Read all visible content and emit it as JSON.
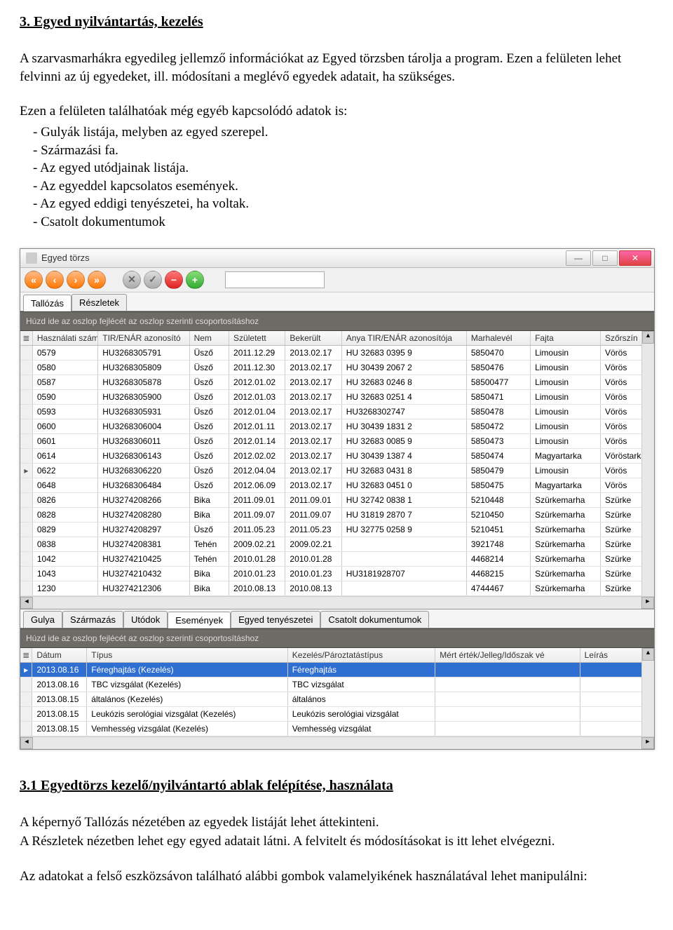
{
  "doc": {
    "h1": "3. Egyed nyilvántartás, kezelés",
    "p1": "A szarvasmarhákra egyedileg jellemző információkat az Egyed törzsben tárolja a program. Ezen a felületen lehet felvinni az új egyedeket, ill. módosítani a meglévő egyedek adatait, ha szükséges.",
    "p2": "Ezen a felületen találhatóak még egyéb kapcsolódó adatok is:",
    "list": [
      "Gulyák listája, melyben az egyed szerepel.",
      "Származási fa.",
      "Az egyed utódjainak listája.",
      "Az egyeddel kapcsolatos események.",
      "Az egyed eddigi tenyészetei, ha voltak.",
      "Csatolt dokumentumok"
    ],
    "h2": "3.1 Egyedtörzs kezelő/nyilvántartó ablak felépítése, használata",
    "p3": "A képernyő Tallózás nézetében az egyedek listáját lehet áttekinteni.",
    "p4": "A Részletek nézetben lehet egy egyed adatait látni. A felvitelt és módosításokat is itt lehet elvégezni.",
    "p5": "Az adatokat a felső eszközsávon található alábbi gombok valamelyikének használatával lehet manipulálni:"
  },
  "window": {
    "title": "Egyed törzs",
    "tabs": [
      "Tallózás",
      "Részletek"
    ],
    "group_hint": "Húzd ide az oszlop fejlécét az oszlop szerinti csoportosításhoz",
    "top_columns": [
      "Használati szám",
      "TIR/ENÁR azonosító",
      "Nem",
      "Született",
      "Bekerült",
      "Anya TIR/ENÁR azonosítója",
      "Marhalevél",
      "Fajta",
      "Szőrszín"
    ],
    "top_rows": [
      {
        "m": " ",
        "c": [
          "0579",
          "HU3268305791",
          "Üsző",
          "2011.12.29",
          "2013.02.17",
          "HU 32683 0395 9",
          "5850470",
          "Limousin",
          "Vörös"
        ]
      },
      {
        "m": " ",
        "c": [
          "0580",
          "HU3268305809",
          "Üsző",
          "2011.12.30",
          "2013.02.17",
          "HU 30439 2067 2",
          "5850476",
          "Limousin",
          "Vörös"
        ]
      },
      {
        "m": " ",
        "c": [
          "0587",
          "HU3268305878",
          "Üsző",
          "2012.01.02",
          "2013.02.17",
          "HU 32683 0246 8",
          "58500477",
          "Limousin",
          "Vörös"
        ]
      },
      {
        "m": " ",
        "c": [
          "0590",
          "HU3268305900",
          "Üsző",
          "2012.01.03",
          "2013.02.17",
          "HU 32683 0251 4",
          "5850471",
          "Limousin",
          "Vörös"
        ]
      },
      {
        "m": " ",
        "c": [
          "0593",
          "HU3268305931",
          "Üsző",
          "2012.01.04",
          "2013.02.17",
          "HU3268302747",
          "5850478",
          "Limousin",
          "Vörös"
        ]
      },
      {
        "m": " ",
        "c": [
          "0600",
          "HU3268306004",
          "Üsző",
          "2012.01.11",
          "2013.02.17",
          "HU 30439 1831 2",
          "5850472",
          "Limousin",
          "Vörös"
        ]
      },
      {
        "m": " ",
        "c": [
          "0601",
          "HU3268306011",
          "Üsző",
          "2012.01.14",
          "2013.02.17",
          "HU 32683 0085 9",
          "5850473",
          "Limousin",
          "Vörös"
        ]
      },
      {
        "m": " ",
        "c": [
          "0614",
          "HU3268306143",
          "Üsző",
          "2012.02.02",
          "2013.02.17",
          "HU 30439 1387 4",
          "5850474",
          "Magyartarka",
          "Vöröstarka"
        ]
      },
      {
        "m": "▸",
        "c": [
          "0622",
          "HU3268306220",
          "Üsző",
          "2012.04.04",
          "2013.02.17",
          "HU 32683 0431 8",
          "5850479",
          "Limousin",
          "Vörös"
        ]
      },
      {
        "m": " ",
        "c": [
          "0648",
          "HU3268306484",
          "Üsző",
          "2012.06.09",
          "2013.02.17",
          "HU 32683 0451 0",
          "5850475",
          "Magyartarka",
          "Vörös"
        ]
      },
      {
        "m": " ",
        "c": [
          "0826",
          "HU3274208266",
          "Bika",
          "2011.09.01",
          "2011.09.01",
          "HU 32742 0838 1",
          "5210448",
          "Szürkemarha",
          "Szürke"
        ]
      },
      {
        "m": " ",
        "c": [
          "0828",
          "HU3274208280",
          "Bika",
          "2011.09.07",
          "2011.09.07",
          "HU 31819 2870 7",
          "5210450",
          "Szürkemarha",
          "Szürke"
        ]
      },
      {
        "m": " ",
        "c": [
          "0829",
          "HU3274208297",
          "Üsző",
          "2011.05.23",
          "2011.05.23",
          "HU 32775 0258 9",
          "5210451",
          "Szürkemarha",
          "Szürke"
        ]
      },
      {
        "m": " ",
        "c": [
          "0838",
          "HU3274208381",
          "Tehén",
          "2009.02.21",
          "2009.02.21",
          "",
          "3921748",
          "Szürkemarha",
          "Szürke"
        ]
      },
      {
        "m": " ",
        "c": [
          "1042",
          "HU3274210425",
          "Tehén",
          "2010.01.28",
          "2010.01.28",
          "",
          "4468214",
          "Szürkemarha",
          "Szürke"
        ]
      },
      {
        "m": " ",
        "c": [
          "1043",
          "HU3274210432",
          "Bika",
          "2010.01.23",
          "2010.01.23",
          "HU3181928707",
          "4468215",
          "Szürkemarha",
          "Szürke"
        ]
      },
      {
        "m": " ",
        "c": [
          "1230",
          "HU3274212306",
          "Bika",
          "2010.08.13",
          "2010.08.13",
          "",
          "4744467",
          "Szürkemarha",
          "Szürke"
        ]
      }
    ],
    "sub_tabs": [
      "Gulya",
      "Származás",
      "Utódok",
      "Események",
      "Egyed tenyészetei",
      "Csatolt dokumentumok"
    ],
    "bot_columns": [
      "Dátum",
      "Típus",
      "Kezelés/Pároztatástípus",
      "Mért érték/Jelleg/Időszak vé",
      "Leírás"
    ],
    "bot_rows": [
      {
        "sel": true,
        "c": [
          "2013.08.16",
          "Féreghajtás (Kezelés)",
          "Féreghajtás",
          "",
          ""
        ]
      },
      {
        "sel": false,
        "c": [
          "2013.08.16",
          "TBC vizsgálat (Kezelés)",
          "TBC vizsgálat",
          "",
          ""
        ]
      },
      {
        "sel": false,
        "c": [
          "2013.08.15",
          "általános (Kezelés)",
          "általános",
          "",
          ""
        ]
      },
      {
        "sel": false,
        "c": [
          "2013.08.15",
          "Leukózis serológiai vizsgálat (Kezelés)",
          "Leukózis serológiai vizsgálat",
          "",
          ""
        ]
      },
      {
        "sel": false,
        "c": [
          "2013.08.15",
          "Vemhesség vizsgálat (Kezelés)",
          "Vemhesség vizsgálat",
          "",
          ""
        ]
      }
    ]
  }
}
